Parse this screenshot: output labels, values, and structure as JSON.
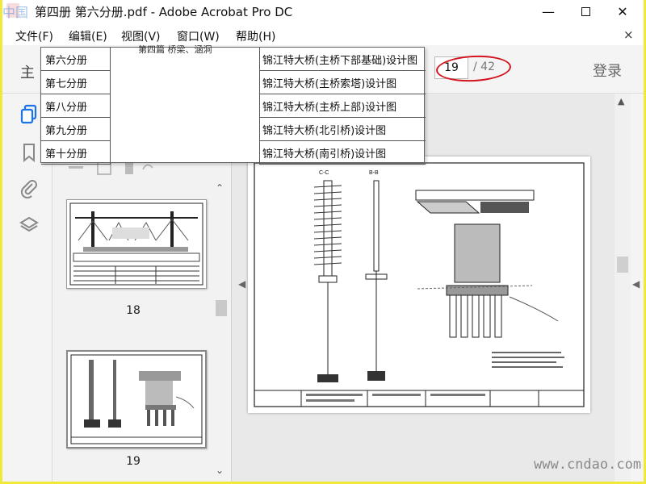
{
  "window": {
    "title": "第四册 第六分册.pdf - Adobe Acrobat Pro DC",
    "minimize_label": "—",
    "close_label": "✕"
  },
  "watermark_top_left": "中国",
  "watermark_bottom_right": "www.cndao.com",
  "menu": {
    "items": [
      "文件(F)",
      "编辑(E)",
      "视图(V)",
      "窗口(W)",
      "帮助(H)"
    ],
    "close_label": "×"
  },
  "toolbar": {
    "home_label": "主",
    "page_current": "19",
    "page_total": "/ 42",
    "login_label": "登录"
  },
  "rail": {
    "icons": [
      "copy-pages-icon",
      "bookmark-icon",
      "attachment-icon",
      "layers-icon"
    ]
  },
  "thumbnails": {
    "items": [
      {
        "label": "18"
      },
      {
        "label": "19"
      }
    ]
  },
  "popup": {
    "header": "第四篇 桥梁、涵洞",
    "left_items": [
      "第六分册",
      "第七分册",
      "第八分册",
      "第九分册",
      "第十分册"
    ],
    "right_items": [
      "锦江特大桥(主桥下部基础)设计图",
      "锦江特大桥(主桥索塔)设计图",
      "锦江特大桥(主桥上部)设计图",
      "锦江特大桥(北引桥)设计图",
      "锦江特大桥(南引桥)设计图"
    ]
  },
  "colors": {
    "accent": "#1a73e8",
    "annotation_red": "#d4141e",
    "background_yellow": "#f0e93a"
  }
}
